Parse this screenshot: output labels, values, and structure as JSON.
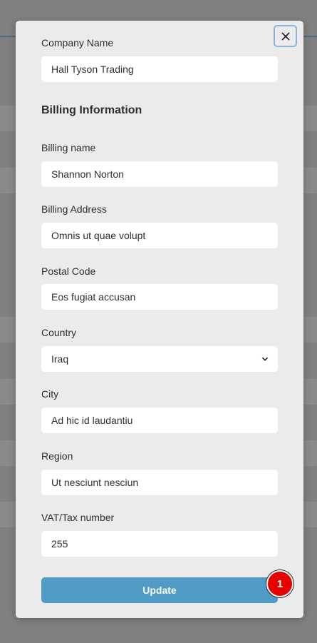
{
  "modal": {
    "close_icon": "close-icon",
    "company_name": {
      "label": "Company Name",
      "value": "Hall Tyson Trading"
    },
    "billing_section_title": "Billing Information",
    "billing_name": {
      "label": "Billing name",
      "value": "Shannon Norton"
    },
    "billing_address": {
      "label": "Billing Address",
      "value": "Omnis ut quae volupt"
    },
    "postal_code": {
      "label": "Postal Code",
      "value": "Eos fugiat accusan"
    },
    "country": {
      "label": "Country",
      "value": "Iraq",
      "icon": "chevron-down-icon"
    },
    "city": {
      "label": "City",
      "value": "Ad hic id laudantiu"
    },
    "region": {
      "label": "Region",
      "value": "Ut nesciunt nesciun"
    },
    "vat": {
      "label": "VAT/Tax number",
      "value": "255"
    },
    "update_label": "Update",
    "badge_count": "1"
  },
  "colors": {
    "overlay": "#808080",
    "modal_bg": "#ebebeb",
    "button": "#4f9bc6",
    "badge": "#e60000"
  }
}
